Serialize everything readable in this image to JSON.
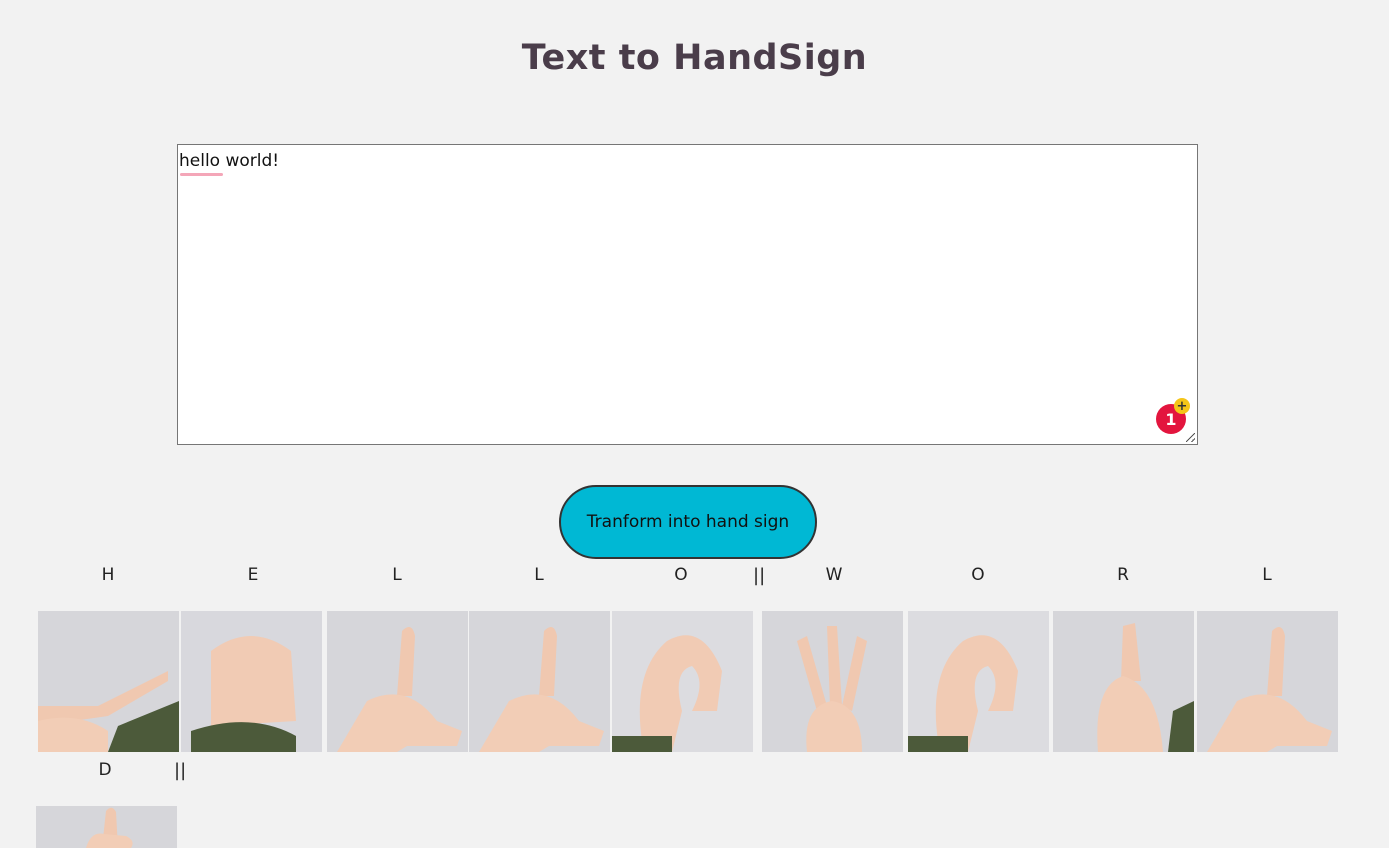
{
  "page": {
    "title": "Text to HandSign"
  },
  "input": {
    "value": "hello world!",
    "grammar_count": "1",
    "grammar_plus": "+"
  },
  "button": {
    "label": "Tranform into hand sign"
  },
  "separator": "||",
  "letters": [
    "H",
    "E",
    "L",
    "L",
    "O",
    "W",
    "O",
    "R",
    "L",
    "D"
  ],
  "colors": {
    "background": "#f2f2f2",
    "button": "#00b8d4",
    "title": "#4a3d4a",
    "badge": "#e3153e"
  },
  "icons": [
    "grammar-check-icon",
    "resize-grip-icon"
  ]
}
